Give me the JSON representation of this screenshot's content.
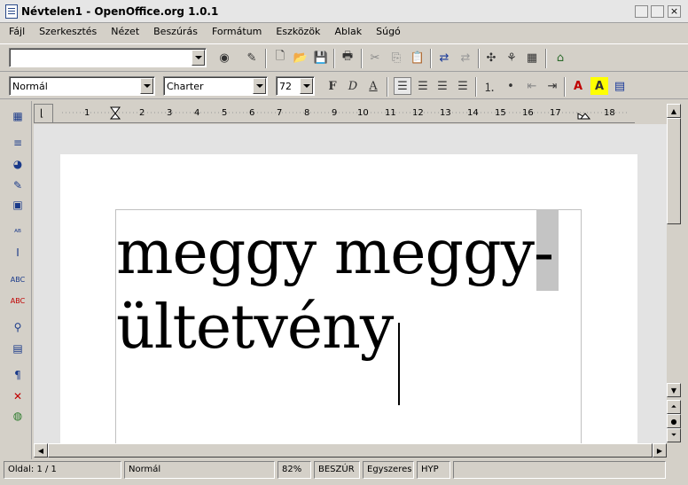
{
  "window": {
    "title": "Névtelen1 - OpenOffice.org 1.0.1"
  },
  "menu": [
    {
      "label": "Fájl"
    },
    {
      "label": "Szerkesztés"
    },
    {
      "label": "Nézet"
    },
    {
      "label": "Beszúrás"
    },
    {
      "label": "Formátum"
    },
    {
      "label": "Eszközök"
    },
    {
      "label": "Ablak"
    },
    {
      "label": "Súgó"
    }
  ],
  "toolbar": {
    "url_value": "",
    "style_value": "Normál",
    "font_value": "Charter",
    "size_value": "72"
  },
  "ruler": {
    "ticks": [
      "1",
      "2",
      "3",
      "4",
      "5",
      "6",
      "7",
      "8",
      "9",
      "10",
      "11",
      "12",
      "13",
      "14",
      "15",
      "16",
      "17",
      "18"
    ]
  },
  "document": {
    "line1": "meggy meggy-",
    "line2": "ültetvény"
  },
  "status": {
    "page": "Oldal: 1 / 1",
    "style": "Normál",
    "zoom": "82%",
    "insert_mode": "BESZÚR",
    "selection_mode": "Egyszeres",
    "hyphenation": "HYP",
    "extra": ""
  }
}
